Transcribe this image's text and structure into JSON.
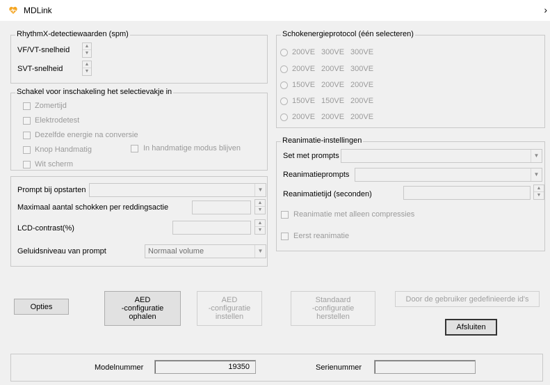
{
  "window": {
    "title": "MDLink",
    "icon": "heart-pulse-icon",
    "close_glyph": "›"
  },
  "rhythm_group": {
    "legend": "RhythmX-detectiewaarden (spm)",
    "vf_label": "VF/VT-snelheid",
    "svt_label": "SVT-snelheid"
  },
  "switch_group": {
    "legend": "Schakel voor inschakeling het selectievakje in",
    "items": [
      {
        "label": "Zomertijd",
        "checked": false
      },
      {
        "label": "Elektrodetest",
        "checked": false
      },
      {
        "label": "Dezelfde energie na conversie",
        "checked": false
      },
      {
        "label": "Knop Handmatig",
        "checked": false
      },
      {
        "label": "Wit scherm",
        "checked": false
      }
    ],
    "manual_mode_label": "In handmatige modus blijven"
  },
  "prompt_group": {
    "startup_prompt_label": "Prompt bij opstarten",
    "startup_prompt_value": "",
    "max_shocks_label": "Maximaal aantal schokken per reddingsactie",
    "max_shocks_value": "",
    "lcd_label": "LCD-contrast(%)",
    "lcd_value": "",
    "volume_label": "Geluidsniveau van prompt",
    "volume_value": "Normaal volume"
  },
  "shock_group": {
    "legend": "Schokenergieprotocol (één selecteren)",
    "options": [
      {
        "e1": "200VE",
        "e2": "300VE",
        "e3": "300VE"
      },
      {
        "e1": "200VE",
        "e2": "200VE",
        "e3": "300VE"
      },
      {
        "e1": "150VE",
        "e2": "200VE",
        "e3": "200VE"
      },
      {
        "e1": "150VE",
        "e2": "150VE",
        "e3": "200VE"
      },
      {
        "e1": "200VE",
        "e2": "200VE",
        "e3": "200VE"
      }
    ]
  },
  "cpr_group": {
    "legend": "Reanimatie-instellingen",
    "set_prompts_label": "Set met prompts",
    "set_prompts_value": "",
    "prompts_label": "Reanimatieprompts",
    "prompts_value": "",
    "time_label": "Reanimatietijd (seconden)",
    "time_value": "",
    "compressions_only_label": "Reanimatie met alleen compressies",
    "first_cpr_label": "Eerst reanimatie"
  },
  "buttons": {
    "options": "Opties",
    "get_config": "AED\n-configuratie\nophalen",
    "set_config": "AED\n-configuratie\ninstellen",
    "restore_default": "Standaard\n-configuratie\nherstellen",
    "user_ids": "Door de gebruiker gedefinieerde id's",
    "close": "Afsluiten"
  },
  "footer": {
    "model_label": "Modelnummer",
    "model_value": "19350",
    "serial_label": "Serienummer",
    "serial_value": ""
  }
}
